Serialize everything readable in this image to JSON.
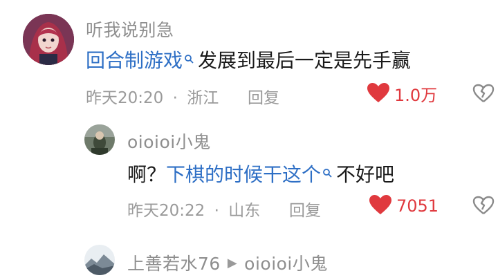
{
  "comment1": {
    "username": "听我说别急",
    "link_text": "回合制游戏",
    "text_rest": "发展到最后一定是先手赢",
    "date": "昨天20:20",
    "separator": "·",
    "location": "浙江",
    "reply_label": "回复",
    "likes": "1.0万"
  },
  "comment2": {
    "username": "oioioi小鬼",
    "text_prefix": "啊？",
    "link_text": "下棋的时候干这个",
    "text_rest": "不好吧",
    "date": "昨天20:22",
    "separator": "·",
    "location": "山东",
    "reply_label": "回复",
    "likes": "7051"
  },
  "comment3": {
    "username": "上善若水76",
    "reply_to": "oioioi小鬼"
  },
  "colors": {
    "link": "#2e6fc5",
    "like_active": "#e0393e",
    "meta_gray": "#9a9a9a"
  },
  "icons": [
    "search-icon",
    "heart-icon",
    "broken-heart-icon",
    "triangle-right-icon"
  ]
}
